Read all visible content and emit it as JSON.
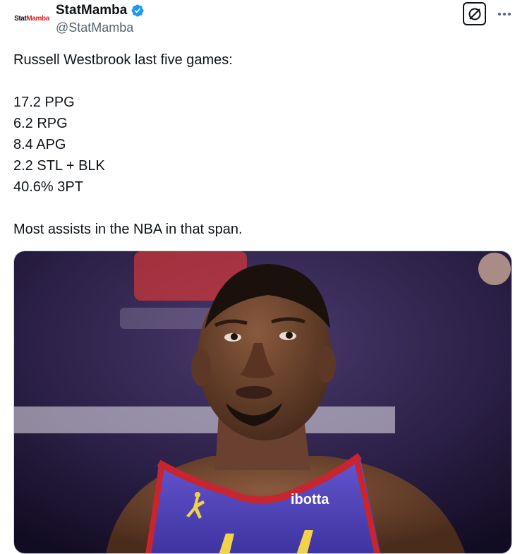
{
  "account": {
    "avatar_text_dark": "Stat",
    "avatar_text_red": "Mamba",
    "display_name": "StatMamba",
    "handle": "@StatMamba",
    "verified_icon": "verified-badge-icon",
    "verified_color": "#1d9bf0"
  },
  "actions": {
    "grok_icon": "grok-icon",
    "more_icon": "more-icon"
  },
  "tweet": {
    "lines": [
      "Russell Westbrook last five games:",
      "17.2 PPG",
      "6.2 RPG",
      "8.4 APG",
      "2.2 STL + BLK",
      "40.6% 3PT",
      "Most assists in the NBA in that span."
    ]
  },
  "media": {
    "jersey_sponsor": "ibotta",
    "jersey_color": "#5b4fc4",
    "jersey_trim_color": "#c8252f"
  }
}
